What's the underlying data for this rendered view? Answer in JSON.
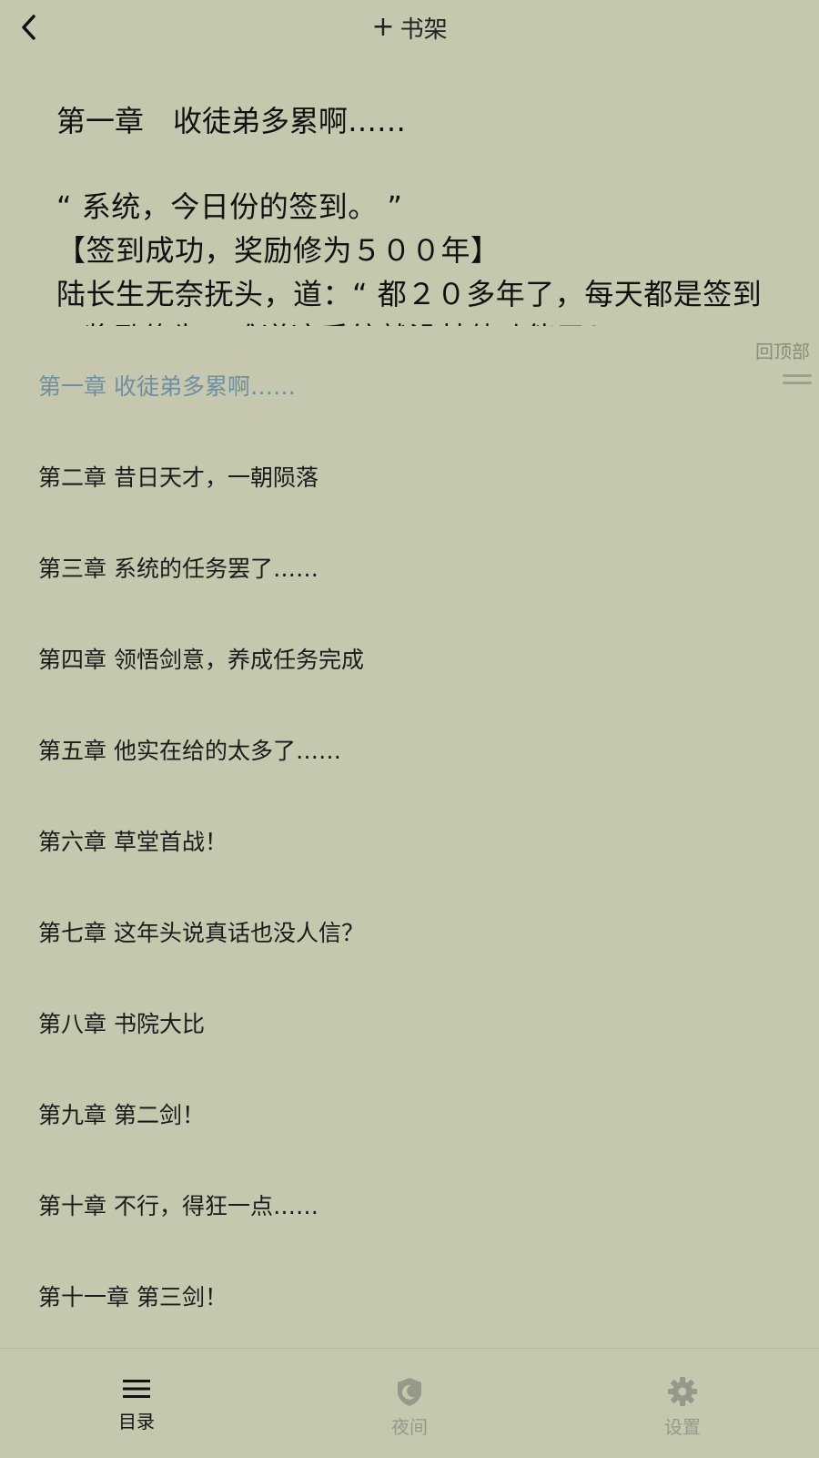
{
  "header": {
    "back_icon": "chevron-left-icon",
    "bookshelf_plus": "+",
    "bookshelf_label": "书架"
  },
  "reader": {
    "chapter_title": "第一章　收徒弟多累啊……",
    "paragraphs": [
      "“ 系统，今日份的签到。 ”",
      "【签到成功，奖励修为５００年】",
      "陆长生无奈抚头，道：“ 都２０多年了，每天都是签到",
      "奖励修为，难道这系统就没其他功能了？ ”"
    ]
  },
  "back_to_top": "回顶部",
  "toc": {
    "items": [
      {
        "label": "第一章 收徒弟多累啊……",
        "active": true
      },
      {
        "label": "第二章 昔日天才，一朝陨落",
        "active": false
      },
      {
        "label": "第三章 系统的任务罢了……",
        "active": false
      },
      {
        "label": "第四章 领悟剑意，养成任务完成",
        "active": false
      },
      {
        "label": "第五章 他实在给的太多了……",
        "active": false
      },
      {
        "label": "第六章 草堂首战！",
        "active": false
      },
      {
        "label": "第七章 这年头说真话也没人信？",
        "active": false
      },
      {
        "label": "第八章 书院大比",
        "active": false
      },
      {
        "label": "第九章 第二剑！",
        "active": false
      },
      {
        "label": "第十章 不行，得狂一点……",
        "active": false
      },
      {
        "label": "第十一章 第三剑！",
        "active": false
      }
    ]
  },
  "bottom_tabs": [
    {
      "label": "目录",
      "icon": "menu-icon",
      "active": true
    },
    {
      "label": "夜间",
      "icon": "night-mode-icon",
      "active": false
    },
    {
      "label": "设置",
      "icon": "gear-icon",
      "active": false
    }
  ],
  "colors": {
    "background": "#c5c8ae",
    "active_chapter": "#6f8ea0",
    "inactive_tab": "#969889"
  }
}
